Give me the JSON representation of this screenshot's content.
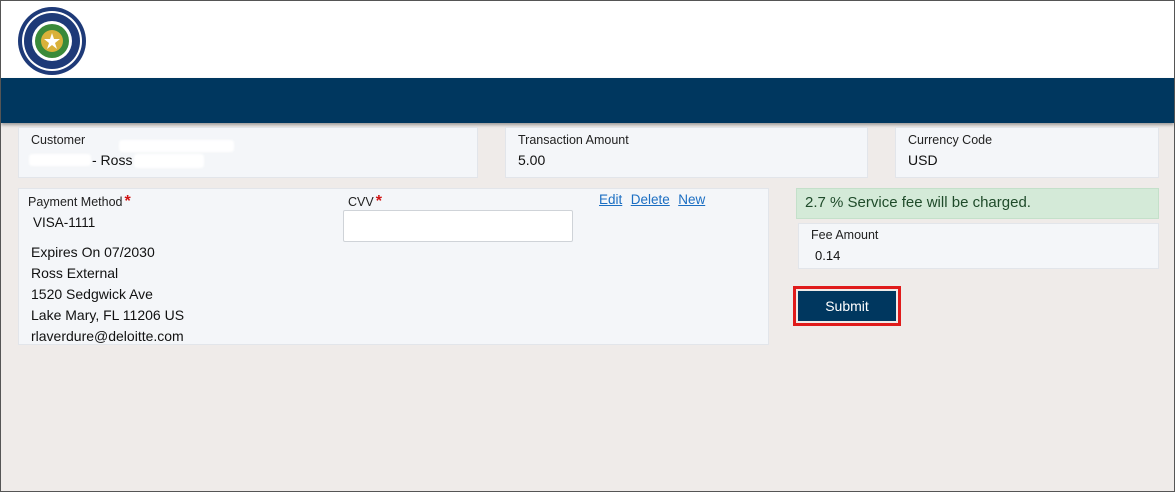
{
  "header": {
    "seal_name": "seal-icon"
  },
  "customer": {
    "label": "Customer",
    "value": "- Ross"
  },
  "transaction": {
    "label": "Transaction Amount",
    "value": "5.00"
  },
  "currency": {
    "label": "Currency Code",
    "value": "USD"
  },
  "payment": {
    "label": "Payment Method",
    "method": "VISA-1111",
    "expires": "Expires On 07/2030",
    "name": "Ross External",
    "street": "1520 Sedgwick Ave",
    "city": "Lake Mary, FL 11206 US",
    "email": "rlaverdure@deloitte.com",
    "edit": "Edit",
    "delete": "Delete",
    "new": "New"
  },
  "cvv": {
    "label": "CVV",
    "value": ""
  },
  "fee": {
    "notice": "2.7 % Service fee will be charged.",
    "label": "Fee Amount",
    "value": "0.14"
  },
  "actions": {
    "submit": "Submit"
  },
  "colors": {
    "navy": "#00375f",
    "required": "#d01414",
    "notice_bg": "#d4ead8",
    "highlight": "#e01b1b"
  }
}
